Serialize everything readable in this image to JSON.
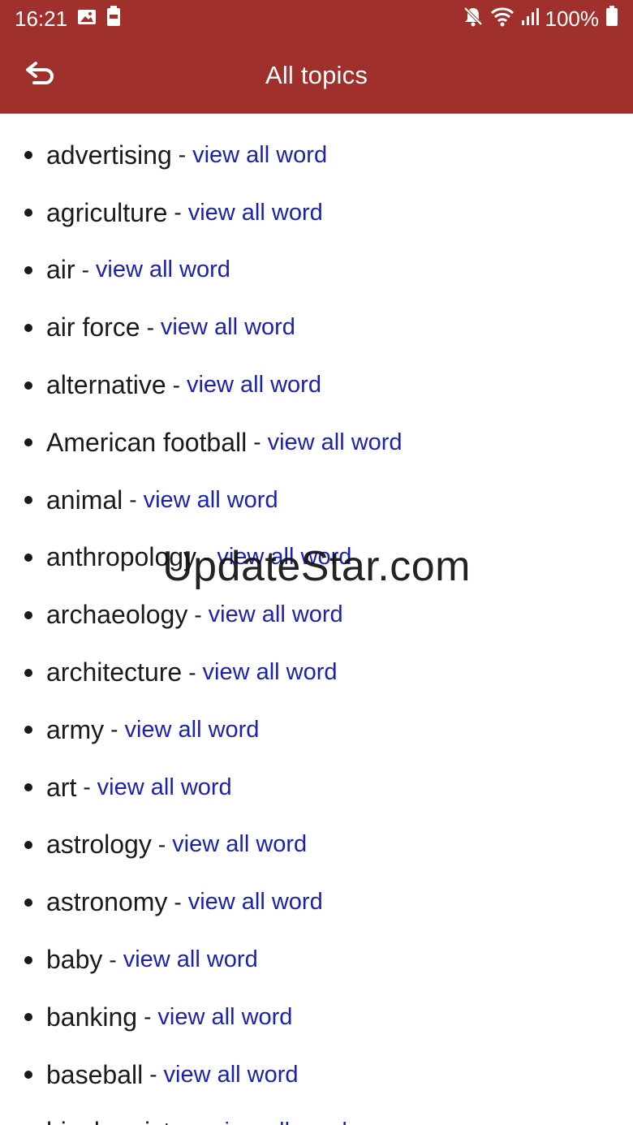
{
  "status_bar": {
    "time": "16:21",
    "battery_percent": "100%",
    "left_icons": [
      "gallery-icon",
      "battery-saver-icon"
    ],
    "right_icons": [
      "mute-icon",
      "wifi-icon",
      "signal-icon",
      "battery-icon"
    ]
  },
  "app_bar": {
    "title": "All topics",
    "back_icon": "back-arrow-icon",
    "color": "#a0302b"
  },
  "list": {
    "link_label": "view all word",
    "separator": "-",
    "link_color": "#1c22b0",
    "items": [
      {
        "topic": "advertising"
      },
      {
        "topic": "agriculture"
      },
      {
        "topic": "air"
      },
      {
        "topic": "air force"
      },
      {
        "topic": "alternative"
      },
      {
        "topic": "American football"
      },
      {
        "topic": "animal"
      },
      {
        "topic": "anthropology"
      },
      {
        "topic": "archaeology"
      },
      {
        "topic": "architecture"
      },
      {
        "topic": "army"
      },
      {
        "topic": "art"
      },
      {
        "topic": "astrology"
      },
      {
        "topic": "astronomy"
      },
      {
        "topic": "baby"
      },
      {
        "topic": "banking"
      },
      {
        "topic": "baseball"
      },
      {
        "topic": "biochemistry"
      }
    ]
  },
  "watermark": "UpdateStar.com"
}
